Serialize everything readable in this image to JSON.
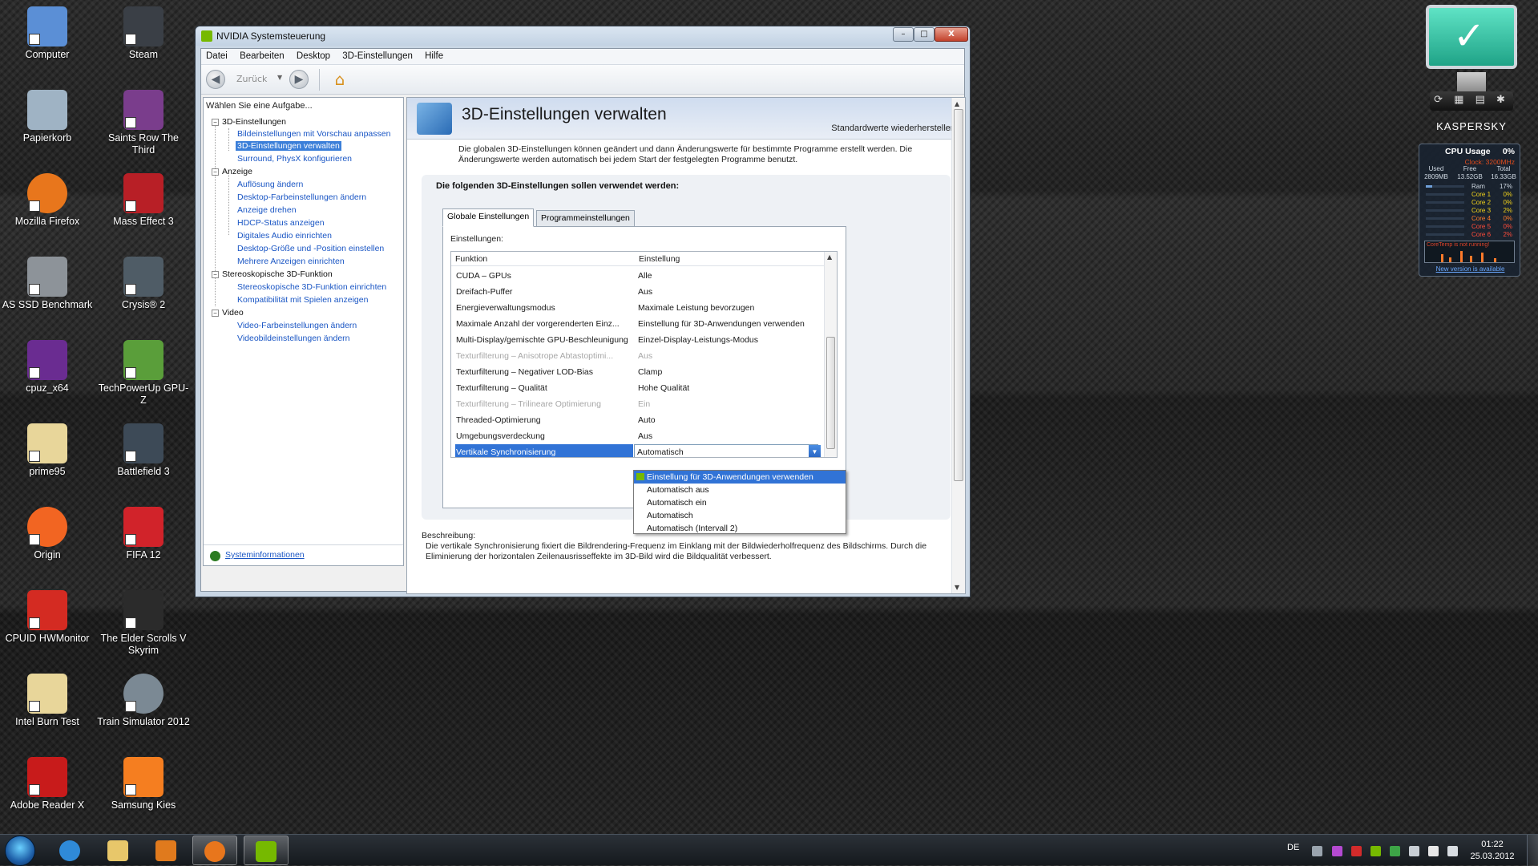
{
  "desktop": {
    "icons": [
      {
        "label": "Computer",
        "color": "#5b8fd6"
      },
      {
        "label": "Steam",
        "color": "#3a3f46"
      },
      {
        "label": "Papierkorb",
        "color": "#9fb3c4"
      },
      {
        "label": "Saints Row The Third",
        "color": "#7a3d8c"
      },
      {
        "label": "Mozilla Firefox",
        "color": "#e8761c"
      },
      {
        "label": "Mass Effect 3",
        "color": "#b81f26"
      },
      {
        "label": "AS SSD Benchmark",
        "color": "#8d9399"
      },
      {
        "label": "Crysis® 2",
        "color": "#4f5c66"
      },
      {
        "label": "cpuz_x64",
        "color": "#6a2c91"
      },
      {
        "label": "TechPowerUp GPU-Z",
        "color": "#5a9e3a"
      },
      {
        "label": "prime95",
        "color": "#e8d69a"
      },
      {
        "label": "Battlefield 3",
        "color": "#3d4a57"
      },
      {
        "label": "Origin",
        "color": "#f26522"
      },
      {
        "label": "FIFA 12",
        "color": "#d1232a"
      },
      {
        "label": "CPUID HWMonitor",
        "color": "#d42b22"
      },
      {
        "label": "The Elder Scrolls V Skyrim",
        "color": "#2b2b2b"
      },
      {
        "label": "Intel Burn Test",
        "color": "#e8d69a"
      },
      {
        "label": "Train Simulator 2012",
        "color": "#7b8994"
      },
      {
        "label": "Adobe Reader X",
        "color": "#c81b1b"
      },
      {
        "label": "Samsung Kies",
        "color": "#f57e20"
      }
    ],
    "icon_second_line": "Skyrim"
  },
  "window": {
    "title": "NVIDIA Systemsteuerung",
    "controls": {
      "minimize": "–",
      "maximize": "□",
      "close": "X"
    },
    "menu": [
      "Datei",
      "Bearbeiten",
      "Desktop",
      "3D-Einstellungen",
      "Hilfe"
    ],
    "toolbar": {
      "back_label": "Zurück",
      "back_arrow": "◀",
      "forward_arrow": "▶",
      "dropdown_arrow": "▼",
      "home_glyph": "⌂"
    },
    "task_pane": {
      "header": "Wählen Sie eine Aufgabe...",
      "categories": [
        {
          "name": "3D-Einstellungen",
          "items": [
            "Bildeinstellungen mit Vorschau anpassen",
            "3D-Einstellungen verwalten",
            "Surround, PhysX konfigurieren"
          ]
        },
        {
          "name": "Anzeige",
          "items": [
            "Auflösung ändern",
            "Desktop-Farbeinstellungen ändern",
            "Anzeige drehen",
            "HDCP-Status anzeigen",
            "Digitales Audio einrichten",
            "Desktop-Größe und -Position einstellen",
            "Mehrere Anzeigen einrichten"
          ]
        },
        {
          "name": "Stereoskopische 3D-Funktion",
          "items": [
            "Stereoskopische 3D-Funktion einrichten",
            "Kompatibilität mit Spielen anzeigen"
          ]
        },
        {
          "name": "Video",
          "items": [
            "Video-Farbeinstellungen ändern",
            "Videobildeinstellungen ändern"
          ]
        }
      ],
      "expander": "−",
      "system_info": "Systeminformationen"
    },
    "content": {
      "title": "3D-Einstellungen verwalten",
      "restore_defaults": "Standardwerte wiederherstellen",
      "intro": "Die globalen 3D-Einstellungen können geändert und dann Änderungswerte für bestimmte Programme erstellt werden. Die Änderungswerte werden automatisch bei jedem Start der festgelegten Programme benutzt.",
      "settings_heading": "Die folgenden 3D-Einstellungen sollen verwendet werden:",
      "tabs": [
        "Globale Einstellungen",
        "Programmeinstellungen"
      ],
      "settings_label": "Einstellungen:",
      "columns": [
        "Funktion",
        "Einstellung"
      ],
      "rows": [
        {
          "function": "CUDA – GPUs",
          "value": "Alle",
          "disabled": false
        },
        {
          "function": "Dreifach-Puffer",
          "value": "Aus",
          "disabled": false
        },
        {
          "function": "Energieverwaltungsmodus",
          "value": "Maximale Leistung bevorzugen",
          "disabled": false
        },
        {
          "function": "Maximale Anzahl der vorgerenderten Einz...",
          "value": "Einstellung für 3D-Anwendungen verwenden",
          "disabled": false
        },
        {
          "function": "Multi-Display/gemischte GPU-Beschleunigung",
          "value": "Einzel-Display-Leistungs-Modus",
          "disabled": false
        },
        {
          "function": "Texturfilterung – Anisotrope Abtastoptimi...",
          "value": "Aus",
          "disabled": true
        },
        {
          "function": "Texturfilterung – Negativer LOD-Bias",
          "value": "Clamp",
          "disabled": false
        },
        {
          "function": "Texturfilterung – Qualität",
          "value": "Hohe Qualität",
          "disabled": false
        },
        {
          "function": "Texturfilterung – Trilineare Optimierung",
          "value": "Ein",
          "disabled": true
        },
        {
          "function": "Threaded-Optimierung",
          "value": "Auto",
          "disabled": false
        },
        {
          "function": "Umgebungsverdeckung",
          "value": "Aus",
          "disabled": false
        },
        {
          "function": "Vertikale Synchronisierung",
          "value": "Automatisch",
          "disabled": false
        }
      ],
      "dropdown_options": [
        "Einstellung für 3D-Anwendungen verwenden",
        "Automatisch aus",
        "Automatisch ein",
        "Automatisch",
        "Automatisch (Intervall 2)"
      ],
      "description_label": "Beschreibung:",
      "description": "Die vertikale Synchronisierung fixiert die Bildrendering-Frequenz im Einklang mit der Bildwiederholfrequenz des Bildschirms. Durch die Eliminierung der horizontalen Zeilenausrisseffekte im 3D-Bild wird die Bildqualität verbessert."
    }
  },
  "kaspersky": {
    "brand": "KASPERSKY",
    "check": "✓",
    "toolbar": "⟳ ▦ ▤ ✱"
  },
  "cpu_gadget": {
    "title": "CPU Usage",
    "usage": "0%",
    "clock": "Clock: 3200MHz",
    "memory": [
      {
        "label": "Used",
        "value": "2809MB"
      },
      {
        "label": "Free",
        "value": "13.52GB"
      },
      {
        "label": "Total",
        "value": "16.33GB"
      }
    ],
    "ram": {
      "label": "Ram",
      "value": "17%"
    },
    "cores": [
      {
        "name": "Core 1",
        "value": "0%",
        "color": "#f2d21b"
      },
      {
        "name": "Core 2",
        "value": "0%",
        "color": "#f2d21b"
      },
      {
        "name": "Core 3",
        "value": "2%",
        "color": "#f2d21b"
      },
      {
        "name": "Core 4",
        "value": "0%",
        "color": "#ff7a2a"
      },
      {
        "name": "Core 5",
        "value": "0%",
        "color": "#ff4b3a"
      },
      {
        "name": "Core 6",
        "value": "2%",
        "color": "#ff4b3a"
      }
    ],
    "warning": "CoreTemp is not running!",
    "new_version": "New version is available"
  },
  "taskbar": {
    "language": "DE",
    "time": "01:22",
    "date": "25.03.2012",
    "apps": [
      {
        "name": "Internet Explorer",
        "color": "#2f8ad8"
      },
      {
        "name": "Windows Explorer",
        "color": "#e8c76a"
      },
      {
        "name": "Windows Media Player",
        "color": "#e07a1d"
      },
      {
        "name": "Mozilla Firefox",
        "color": "#e8761c"
      },
      {
        "name": "NVIDIA Systemsteuerung",
        "color": "#76b900"
      }
    ]
  }
}
